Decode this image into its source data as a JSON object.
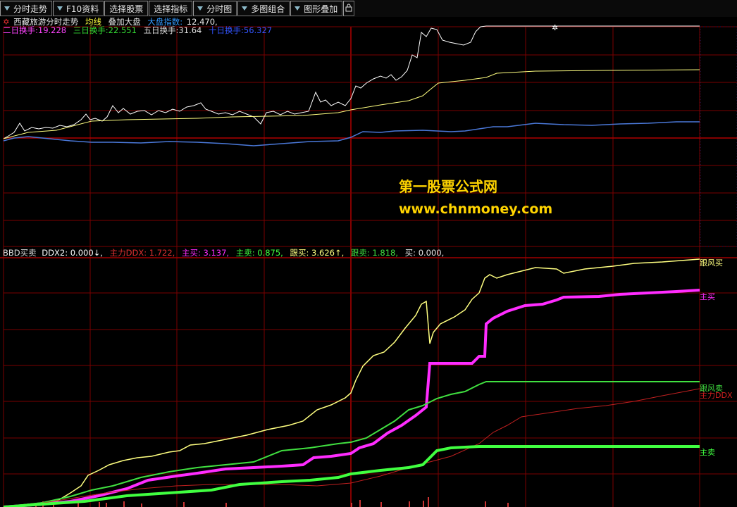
{
  "toolbar": {
    "buttons": [
      {
        "label": "分时走势",
        "arrow": true
      },
      {
        "label": "F10资料",
        "arrow": true
      },
      {
        "label": "选择股票",
        "arrow": false
      },
      {
        "label": "选择指标",
        "arrow": false
      },
      {
        "label": "分时图",
        "arrow": true
      },
      {
        "label": "多图组合",
        "arrow": true
      },
      {
        "label": "图形叠加",
        "arrow": true
      }
    ]
  },
  "header": {
    "stock_title": "西藏旅游分时走势",
    "avg_line": "均线",
    "overlay": "叠加大盘",
    "index_label": "大盘指数:",
    "index_value": "12.470,",
    "turnover2": "二日换手:19.228",
    "turnover3": "三日换手:22.551",
    "turnover5": "五日换手:31.64",
    "turnover10": "十日换手:56.327"
  },
  "indicator": {
    "name": "BBD买卖",
    "ddx2": "DDX2: 0.000↓,",
    "main_ddx": "主力DDX: 1.722,",
    "main_buy": "主买: 3.137,",
    "main_sell": "主卖: 0.875,",
    "follow_buy": "跟买: 3.626↑,",
    "follow_sell": "跟卖: 1.818,",
    "buy": "买: 0.000,"
  },
  "watermark": {
    "line1": "第一股票公式网",
    "line2": "www.chnmoney.com"
  },
  "end_labels": {
    "follow_buy": "跟风买",
    "main_buy": "主买",
    "follow_sell": "跟风卖",
    "main_ddx": "主力DDX",
    "main_sell": "主卖"
  },
  "colors": {
    "grid": "#7a0000",
    "price": "#ffffff",
    "avg": "#ffff80",
    "index": "#4a78d8",
    "follow_buy": "#ffff80",
    "main_buy": "#ff2cff",
    "follow_sell": "#40e040",
    "main_ddx": "#c02020",
    "main_sell": "#40ff40",
    "turnover2": "#ff44ff",
    "turnover3": "#33dd33",
    "turnover5": "#dddddd",
    "turnover10": "#3355ff",
    "stock_title": "#e8e8e8",
    "avg_label": "#ffff40",
    "index_label": "#3399ff"
  }
}
